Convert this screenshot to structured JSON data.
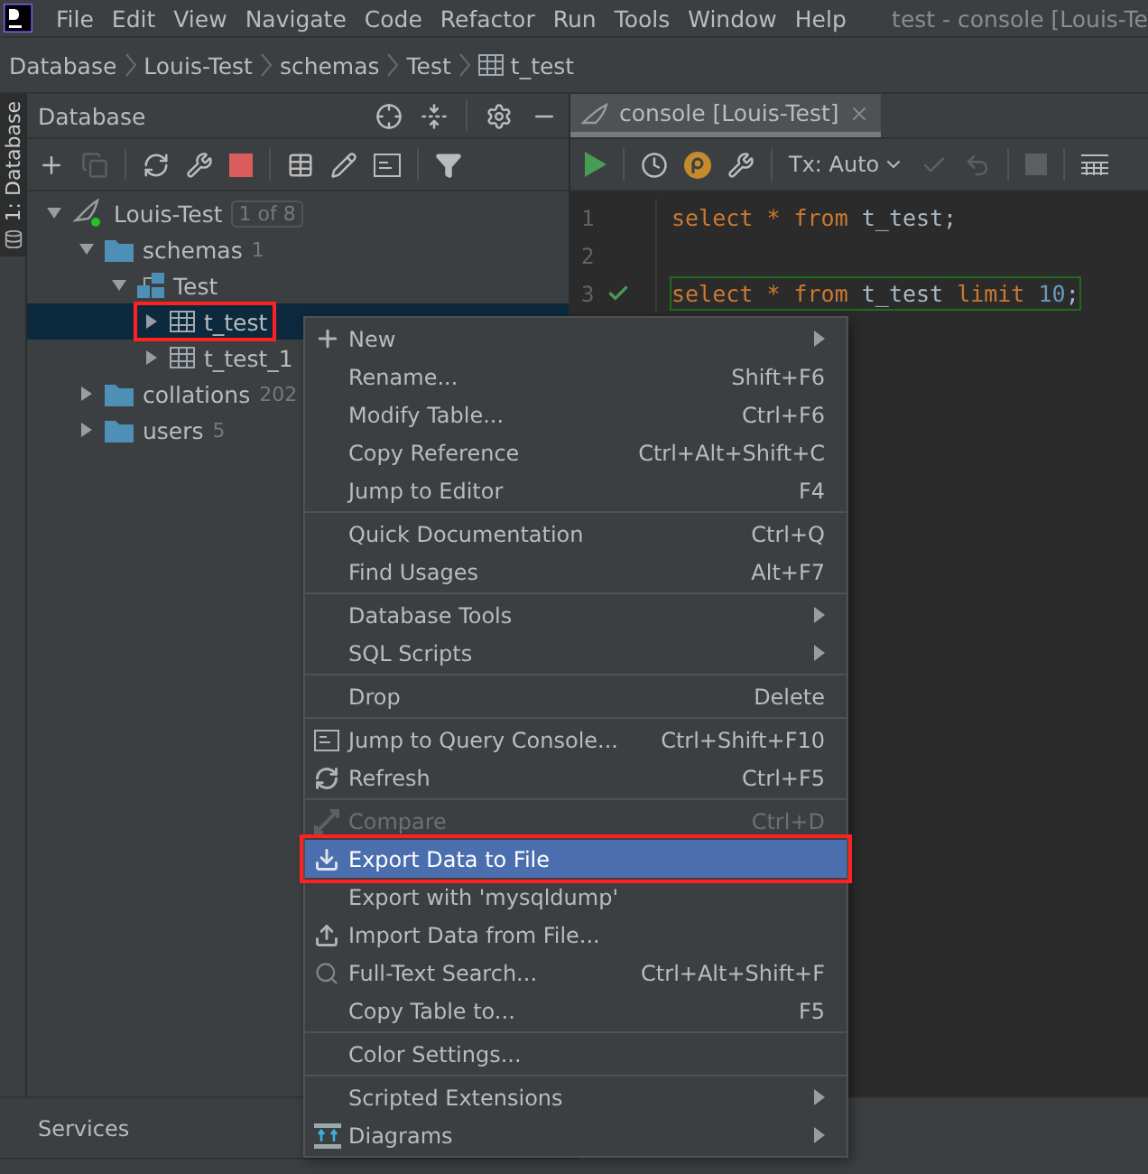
{
  "menubar": {
    "items": [
      {
        "label": "File"
      },
      {
        "label": "Edit"
      },
      {
        "label": "View"
      },
      {
        "label": "Navigate"
      },
      {
        "label": "Code"
      },
      {
        "label": "Refactor"
      },
      {
        "label": "Run"
      },
      {
        "label": "Tools"
      },
      {
        "label": "Window"
      },
      {
        "label": "Help"
      }
    ],
    "title": "test - console [Louis-Te"
  },
  "breadcrumb": [
    {
      "label": "Database",
      "kind": "text"
    },
    {
      "label": "Louis-Test",
      "kind": "text"
    },
    {
      "label": "schemas",
      "kind": "text"
    },
    {
      "label": "Test",
      "kind": "text"
    },
    {
      "label": "t_test",
      "kind": "table"
    }
  ],
  "side_strip": {
    "label": "1: Database"
  },
  "database_panel": {
    "title": "Database",
    "tree": [
      {
        "label": "Louis-Test",
        "kind": "datasource",
        "badge": "1 of 8",
        "expanded": true,
        "selected": false,
        "children": [
          {
            "label": "schemas",
            "kind": "folder",
            "count": "1",
            "expanded": true,
            "selected": false,
            "children": [
              {
                "label": "Test",
                "kind": "schema",
                "expanded": true,
                "selected": false,
                "children": [
                  {
                    "label": "t_test",
                    "kind": "table",
                    "expanded": false,
                    "selected": true,
                    "annotated": true
                  },
                  {
                    "label": "t_test_1",
                    "kind": "table",
                    "expanded": false,
                    "selected": false
                  }
                ]
              }
            ]
          },
          {
            "label": "collations",
            "kind": "folder",
            "count": "202",
            "expanded": false,
            "selected": false
          },
          {
            "label": "users",
            "kind": "folder",
            "count": "5",
            "expanded": false,
            "selected": false
          }
        ]
      }
    ]
  },
  "editor": {
    "tab": {
      "label": "console [Louis-Test]"
    },
    "tx_mode": "Tx: Auto",
    "lines": [
      {
        "number": "1",
        "executed": false,
        "tokens": [
          {
            "kind": "keyword",
            "text": "select"
          },
          {
            "kind": "keyword",
            "text": "*"
          },
          {
            "kind": "keyword",
            "text": "from"
          },
          {
            "kind": "ident",
            "text": "t_test;"
          }
        ]
      },
      {
        "number": "2",
        "executed": false
      },
      {
        "number": "3",
        "executed": true,
        "tokens": [
          {
            "kind": "keyword",
            "text": "select"
          },
          {
            "kind": "keyword",
            "text": "*"
          },
          {
            "kind": "keyword",
            "text": "from"
          },
          {
            "kind": "ident",
            "text": "t_test"
          },
          {
            "kind": "keyword",
            "text": "limit"
          },
          {
            "kind": "number",
            "text": "10"
          },
          {
            "kind": "ident",
            "text": ";"
          }
        ]
      }
    ]
  },
  "services": {
    "title": "Services"
  },
  "context_menu": [
    {
      "kind": "item",
      "label": "New",
      "submenu": true,
      "disabled": false,
      "selected": false
    },
    {
      "kind": "item",
      "label": "Rename...",
      "shortcut": "Shift+F6",
      "disabled": false,
      "selected": false
    },
    {
      "kind": "item",
      "label": "Modify Table...",
      "shortcut": "Ctrl+F6",
      "disabled": false,
      "selected": false
    },
    {
      "kind": "item",
      "label": "Copy Reference",
      "shortcut": "Ctrl+Alt+Shift+C",
      "disabled": false,
      "selected": false
    },
    {
      "kind": "item",
      "label": "Jump to Editor",
      "shortcut": "F4",
      "disabled": false,
      "selected": false
    },
    {
      "kind": "separator"
    },
    {
      "kind": "item",
      "label": "Quick Documentation",
      "shortcut": "Ctrl+Q",
      "disabled": false,
      "selected": false
    },
    {
      "kind": "item",
      "label": "Find Usages",
      "shortcut": "Alt+F7",
      "disabled": false,
      "selected": false
    },
    {
      "kind": "separator"
    },
    {
      "kind": "item",
      "label": "Database Tools",
      "submenu": true,
      "disabled": false,
      "selected": false
    },
    {
      "kind": "item",
      "label": "SQL Scripts",
      "submenu": true,
      "disabled": false,
      "selected": false
    },
    {
      "kind": "separator"
    },
    {
      "kind": "item",
      "label": "Drop",
      "shortcut": "Delete",
      "disabled": false,
      "selected": false
    },
    {
      "kind": "separator"
    },
    {
      "kind": "item",
      "label": "Jump to Query Console...",
      "shortcut": "Ctrl+Shift+F10",
      "disabled": false,
      "selected": false
    },
    {
      "kind": "item",
      "label": "Refresh",
      "shortcut": "Ctrl+F5",
      "disabled": false,
      "selected": false
    },
    {
      "kind": "separator"
    },
    {
      "kind": "item",
      "label": "Compare",
      "shortcut": "Ctrl+D",
      "disabled": true,
      "selected": false
    },
    {
      "kind": "item",
      "label": "Export Data to File",
      "disabled": false,
      "selected": true,
      "annotated": true
    },
    {
      "kind": "item",
      "label": "Export with 'mysqldump'",
      "disabled": false,
      "selected": false
    },
    {
      "kind": "item",
      "label": "Import Data from File...",
      "disabled": false,
      "selected": false
    },
    {
      "kind": "item",
      "label": "Full-Text Search...",
      "shortcut": "Ctrl+Alt+Shift+F",
      "disabled": false,
      "selected": false
    },
    {
      "kind": "item",
      "label": "Copy Table to...",
      "shortcut": "F5",
      "disabled": false,
      "selected": false
    },
    {
      "kind": "separator"
    },
    {
      "kind": "item",
      "label": "Color Settings...",
      "disabled": false,
      "selected": false
    },
    {
      "kind": "separator"
    },
    {
      "kind": "item",
      "label": "Scripted Extensions",
      "submenu": true,
      "disabled": false,
      "selected": false
    },
    {
      "kind": "item",
      "label": "Diagrams",
      "submenu": true,
      "disabled": false,
      "selected": false
    }
  ]
}
